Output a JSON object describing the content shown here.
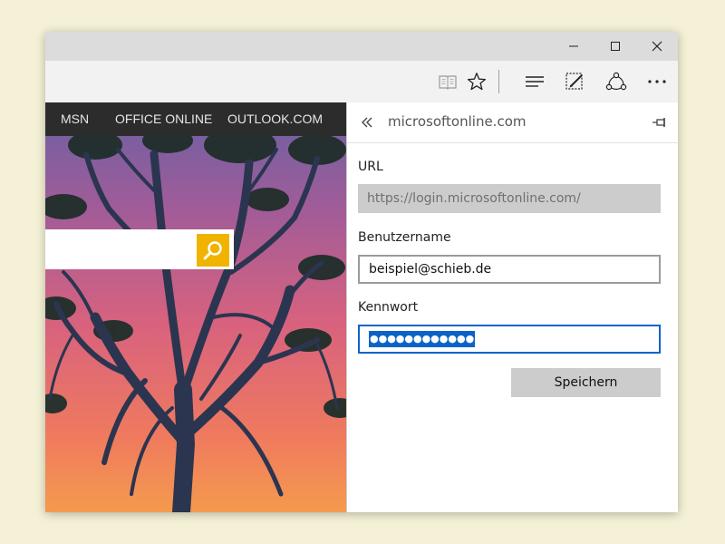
{
  "window": {
    "controls": {
      "minimize": "minimize-icon",
      "maximize": "maximize-icon",
      "close": "close-icon"
    }
  },
  "toolbar": {
    "icons": [
      "reading-view-icon",
      "favorite-star-icon",
      "hub-icon",
      "web-note-icon",
      "share-icon",
      "more-icon"
    ]
  },
  "page": {
    "nav": [
      "MSN",
      "OFFICE ONLINE",
      "OUTLOOK.COM"
    ],
    "search": {
      "value": "",
      "icon": "search-icon",
      "button_color": "#f0b400"
    }
  },
  "panel": {
    "title": "microsoftonline.com",
    "url": {
      "label": "URL",
      "value": "https://login.microsoftonline.com/"
    },
    "username": {
      "label": "Benutzername",
      "value": "beispiel@schieb.de"
    },
    "password": {
      "label": "Kennwort",
      "masked": "●●●●●●●●●●●●"
    },
    "save_label": "Speichern"
  },
  "colors": {
    "accent": "#0a64c8",
    "titlebar": "#dcdcdc",
    "nav_bg": "#2c2c2c"
  }
}
